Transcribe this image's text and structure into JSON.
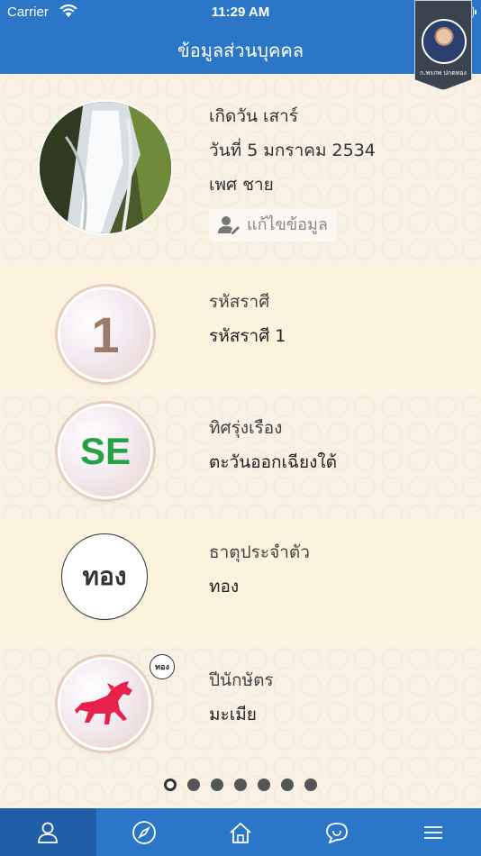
{
  "status_bar": {
    "carrier": "Carrier",
    "time": "11:29 AM"
  },
  "header": {
    "title": "ข้อมูลส่วนบุคคล",
    "badge_caption": "ก.พรภพ ปกตทอง"
  },
  "profile": {
    "birth_day": "เกิดวัน เสาร์",
    "birth_date": "วันที่ 5 มกราคม 2534",
    "gender": "เพศ ชาย",
    "edit_label": "แก้ไขข้อมูล"
  },
  "items": [
    {
      "icon_text": "1",
      "label": "รหัสราศี",
      "value": "รหัสราศี 1"
    },
    {
      "icon_text": "SE",
      "label": "ทิศรุ่งเรือง",
      "value": "ตะวันออกเฉียงใต้"
    },
    {
      "icon_text": "ทอง",
      "label": "ธาตุประจำตัว",
      "value": "ทอง"
    },
    {
      "badge_text": "ทอง",
      "label": "ปีนักษัตร",
      "value": "มะเมีย"
    }
  ],
  "pager": {
    "pages": 7,
    "active": 1
  },
  "tabs": [
    {
      "icon": "user-icon",
      "active": true
    },
    {
      "icon": "compass-icon",
      "active": false
    },
    {
      "icon": "home-icon",
      "active": false
    },
    {
      "icon": "chat-icon",
      "active": false
    },
    {
      "icon": "menu-icon",
      "active": false
    }
  ],
  "colors": {
    "primary": "#2b76c6",
    "direction_green": "#25a244",
    "background": "#f6efdf"
  }
}
